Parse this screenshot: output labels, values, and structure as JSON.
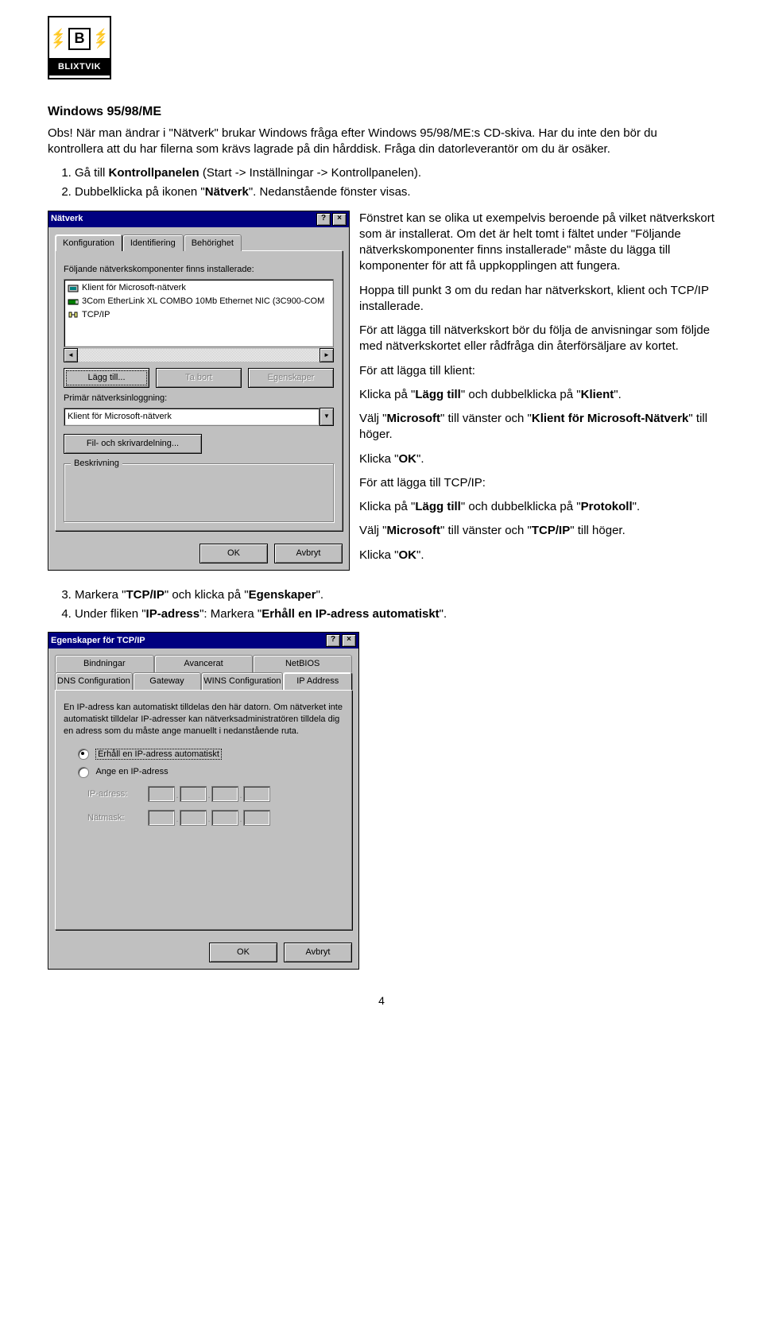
{
  "logo": {
    "brand": "BLIXTVIK",
    "letter": "B"
  },
  "heading": "Windows 95/98/ME",
  "intro1": "Obs! När man ändrar i \"Nätverk\" brukar Windows fråga efter Windows 95/98/ME:s CD-skiva. Har du inte den bör du kontrollera att du har filerna som krävs lagrade på din hårddisk. Fråga din datorleverantör om du är osäker.",
  "step1_pre": "Gå till ",
  "step1_bold": "Kontrollpanelen",
  "step1_post": " (Start -> Inställningar -> Kontrollpanelen).",
  "step2_pre": "Dubbelklicka på ikonen \"",
  "step2_bold": "Nätverk",
  "step2_post": "\". Nedanstående fönster visas.",
  "dialog1": {
    "title": "Nätverk",
    "tabs": [
      "Konfiguration",
      "Identifiering",
      "Behörighet"
    ],
    "list_label": "Följande nätverkskomponenter finns installerade:",
    "items": [
      "Klient för Microsoft-nätverk",
      "3Com EtherLink XL COMBO 10Mb Ethernet NIC (3C900-COM",
      "TCP/IP"
    ],
    "btn_add": "Lägg till...",
    "btn_remove": "Ta bort",
    "btn_props": "Egenskaper",
    "primary_login_label": "Primär nätverksinloggning:",
    "primary_login_value": "Klient för Microsoft-nätverk",
    "btn_share": "Fil- och skrivardelning...",
    "group_desc": "Beskrivning",
    "ok": "OK",
    "cancel": "Avbryt"
  },
  "side": {
    "p1": "Fönstret kan se olika ut exempelvis beroende på vilket nätverkskort som är installerat. Om det är helt tomt i fältet under \"Följande nätverkskomponenter finns installerade\" måste du lägga till komponenter för att få uppkopplingen att fungera.",
    "p2": "Hoppa till punkt 3 om du redan har nätverkskort, klient och TCP/IP installerade.",
    "p3": "För att lägga till nätverkskort bör du följa de anvisningar som följde med nätverkskortet eller rådfråga din återförsäljare av kortet.",
    "p4": "För att lägga till klient:",
    "p5_a": "Klicka på \"",
    "p5_b": "Lägg till",
    "p5_c": "\" och dubbelklicka på \"",
    "p5_d": "Klient",
    "p5_e": "\".",
    "p6_a": "Välj \"",
    "p6_b": "Microsoft",
    "p6_c": "\" till vänster och \"",
    "p6_d": "Klient för Microsoft-Nätverk",
    "p6_e": "\" till höger.",
    "p7_a": "Klicka \"",
    "p7_b": "OK",
    "p7_c": "\".",
    "p8": "För att lägga till TCP/IP:",
    "p9_a": "Klicka på \"",
    "p9_b": "Lägg till",
    "p9_c": "\" och dubbelklicka på \"",
    "p9_d": "Protokoll",
    "p9_e": "\".",
    "p10_a": "Välj \"",
    "p10_b": "Microsoft",
    "p10_c": "\" till vänster och \"",
    "p10_d": "TCP/IP",
    "p10_e": "\" till höger.",
    "p11_a": "Klicka \"",
    "p11_b": "OK",
    "p11_c": "\"."
  },
  "step3_a": "Markera \"",
  "step3_b": "TCP/IP",
  "step3_c": "\" och klicka på \"",
  "step3_d": "Egenskaper",
  "step3_e": "\".",
  "step4_a": "Under fliken \"",
  "step4_b": "IP-adress",
  "step4_c": "\": Markera \"",
  "step4_d": "Erhåll en IP-adress automatiskt",
  "step4_e": "\".",
  "dialog2": {
    "title": "Egenskaper för TCP/IP",
    "tabs_row1": [
      "Bindningar",
      "Avancerat",
      "NetBIOS"
    ],
    "tabs_row2": [
      "DNS Configuration",
      "Gateway",
      "WINS Configuration",
      "IP Address"
    ],
    "explain": "En IP-adress kan automatiskt tilldelas den här datorn. Om nätverket inte automatiskt tilldelar IP-adresser kan nätverksadministratören tilldela dig en adress som du måste ange manuellt i nedanstående ruta.",
    "radio1": "Erhåll en IP-adress automatiskt",
    "radio2": "Ange en IP-adress",
    "field_ip": "IP-adress:",
    "field_mask": "Nätmask:",
    "ok": "OK",
    "cancel": "Avbryt"
  },
  "pagenum": "4"
}
